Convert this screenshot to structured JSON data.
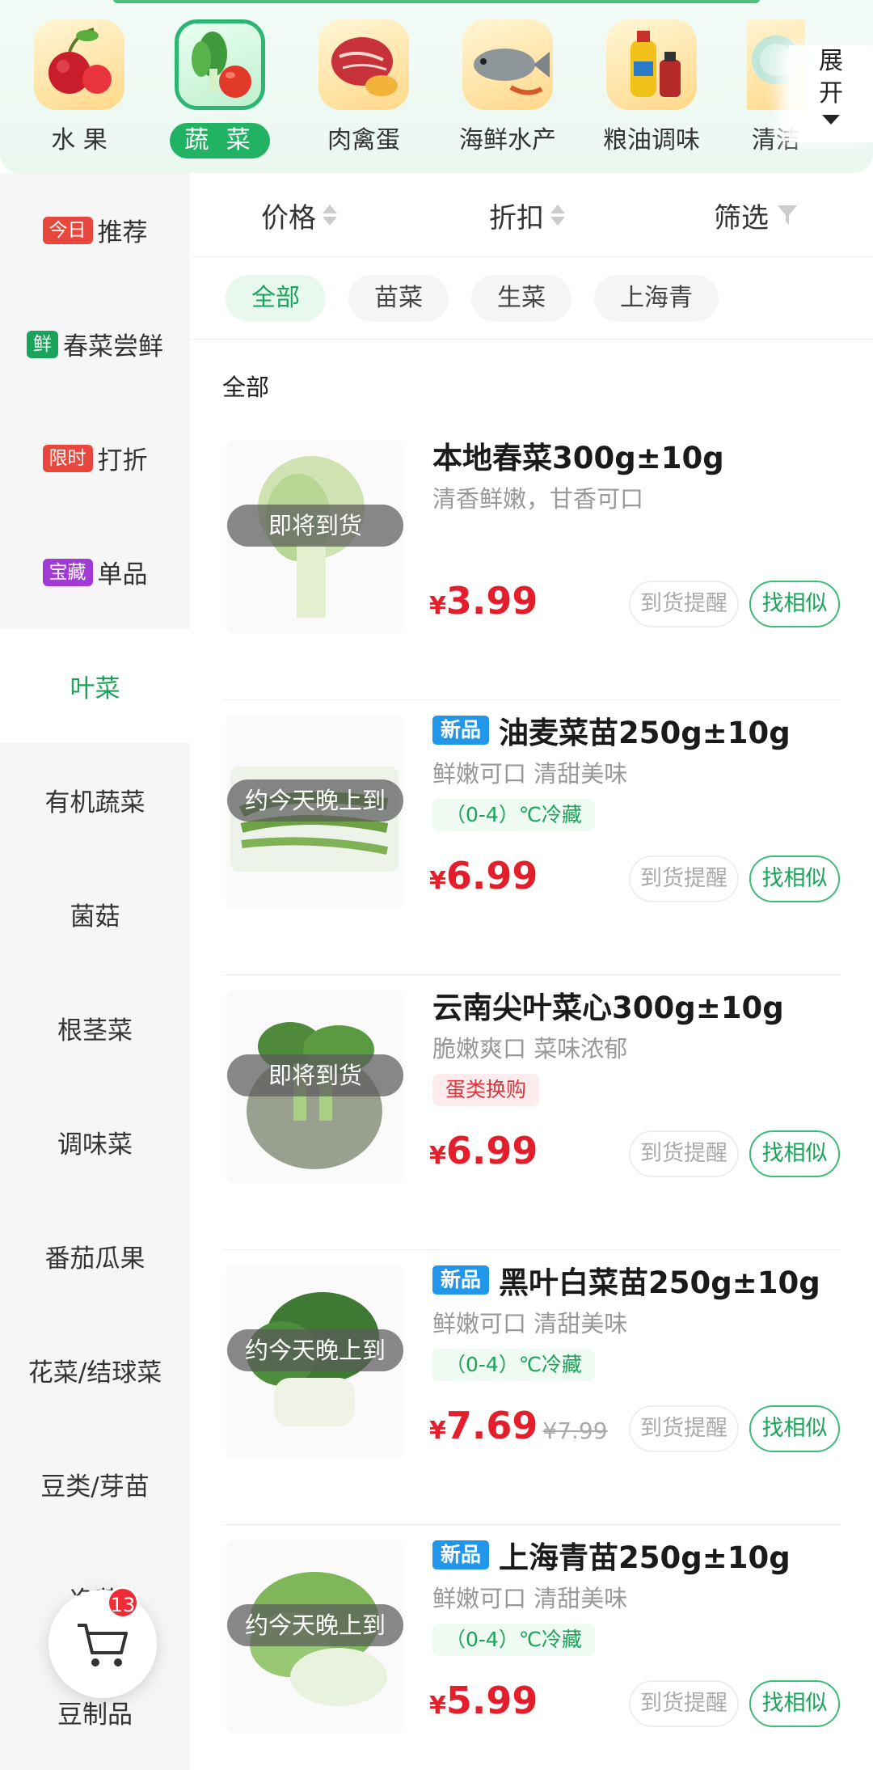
{
  "categories": [
    {
      "label": "水 果",
      "icon": "fruit-icon",
      "active": false
    },
    {
      "label": "蔬 菜",
      "icon": "vegetable-icon",
      "active": true
    },
    {
      "label": "肉禽蛋",
      "icon": "meat-icon",
      "active": false
    },
    {
      "label": "海鲜水产",
      "icon": "seafood-icon",
      "active": false
    },
    {
      "label": "粮油调味",
      "icon": "grain-oil-icon",
      "active": false
    },
    {
      "label": "清洁",
      "icon": "cleaning-icon",
      "active": false
    }
  ],
  "expand": {
    "line1": "展",
    "line2": "开"
  },
  "sidebar": [
    {
      "tag": "今日",
      "tag_color": "#e8473d",
      "label": "推荐"
    },
    {
      "tag": "鲜",
      "tag_color": "#1aa35a",
      "label": "春菜尝鲜"
    },
    {
      "tag": "限时",
      "tag_color": "#e8473d",
      "label": "打折"
    },
    {
      "tag": "宝藏",
      "tag_color": "#a23ad6",
      "label": "单品"
    },
    {
      "tag": "",
      "label": "叶菜",
      "active": true
    },
    {
      "tag": "",
      "label": "有机蔬菜"
    },
    {
      "tag": "",
      "label": "菌菇"
    },
    {
      "tag": "",
      "label": "根茎菜"
    },
    {
      "tag": "",
      "label": "调味菜"
    },
    {
      "tag": "",
      "label": "番茄瓜果"
    },
    {
      "tag": "",
      "label": "花菜/结球菜"
    },
    {
      "tag": "",
      "label": "豆类/芽苗"
    },
    {
      "tag": "",
      "label": "净菜"
    },
    {
      "tag": "",
      "label": "豆制品"
    }
  ],
  "cart": {
    "count": "13"
  },
  "sort": {
    "price": "价格",
    "discount": "折扣",
    "filter": "筛选"
  },
  "chips": [
    {
      "label": "全部",
      "active": true
    },
    {
      "label": "苗菜"
    },
    {
      "label": "生菜"
    },
    {
      "label": "上海青"
    }
  ],
  "section_title": "全部",
  "buttons": {
    "remind": "到货提醒",
    "similar": "找相似"
  },
  "products": [
    {
      "new": "",
      "title": "本地春菜300g±10g",
      "subtitle": "清香鲜嫩，甘香可口",
      "tag": "",
      "tag_style": "",
      "overlay": "即将到货",
      "currency": "¥",
      "price": "3.99",
      "old_price": ""
    },
    {
      "new": "新品",
      "title": "油麦菜苗250g±10g",
      "subtitle": "鲜嫩可口 清甜美味",
      "tag": "（0-4）℃冷藏",
      "tag_style": "green",
      "overlay": "约今天晚上到",
      "currency": "¥",
      "price": "6.99",
      "old_price": ""
    },
    {
      "new": "",
      "title": "云南尖叶菜心300g±10g",
      "subtitle": "脆嫩爽口 菜味浓郁",
      "tag": "蛋类换购",
      "tag_style": "red",
      "overlay": "即将到货",
      "currency": "¥",
      "price": "6.99",
      "old_price": ""
    },
    {
      "new": "新品",
      "title": "黑叶白菜苗250g±10g",
      "subtitle": "鲜嫩可口 清甜美味",
      "tag": "（0-4）℃冷藏",
      "tag_style": "green",
      "overlay": "约今天晚上到",
      "currency": "¥",
      "price": "7.69",
      "old_price": "¥7.99"
    },
    {
      "new": "新品",
      "title": "上海青苗250g±10g",
      "subtitle": "鲜嫩可口 清甜美味",
      "tag": "（0-4）℃冷藏",
      "tag_style": "green",
      "overlay": "约今天晚上到",
      "currency": "¥",
      "price": "5.99",
      "old_price": ""
    }
  ],
  "colors": {
    "accent": "#1aa35a",
    "price": "#e41f2b",
    "new_tag": "#2296e8"
  }
}
